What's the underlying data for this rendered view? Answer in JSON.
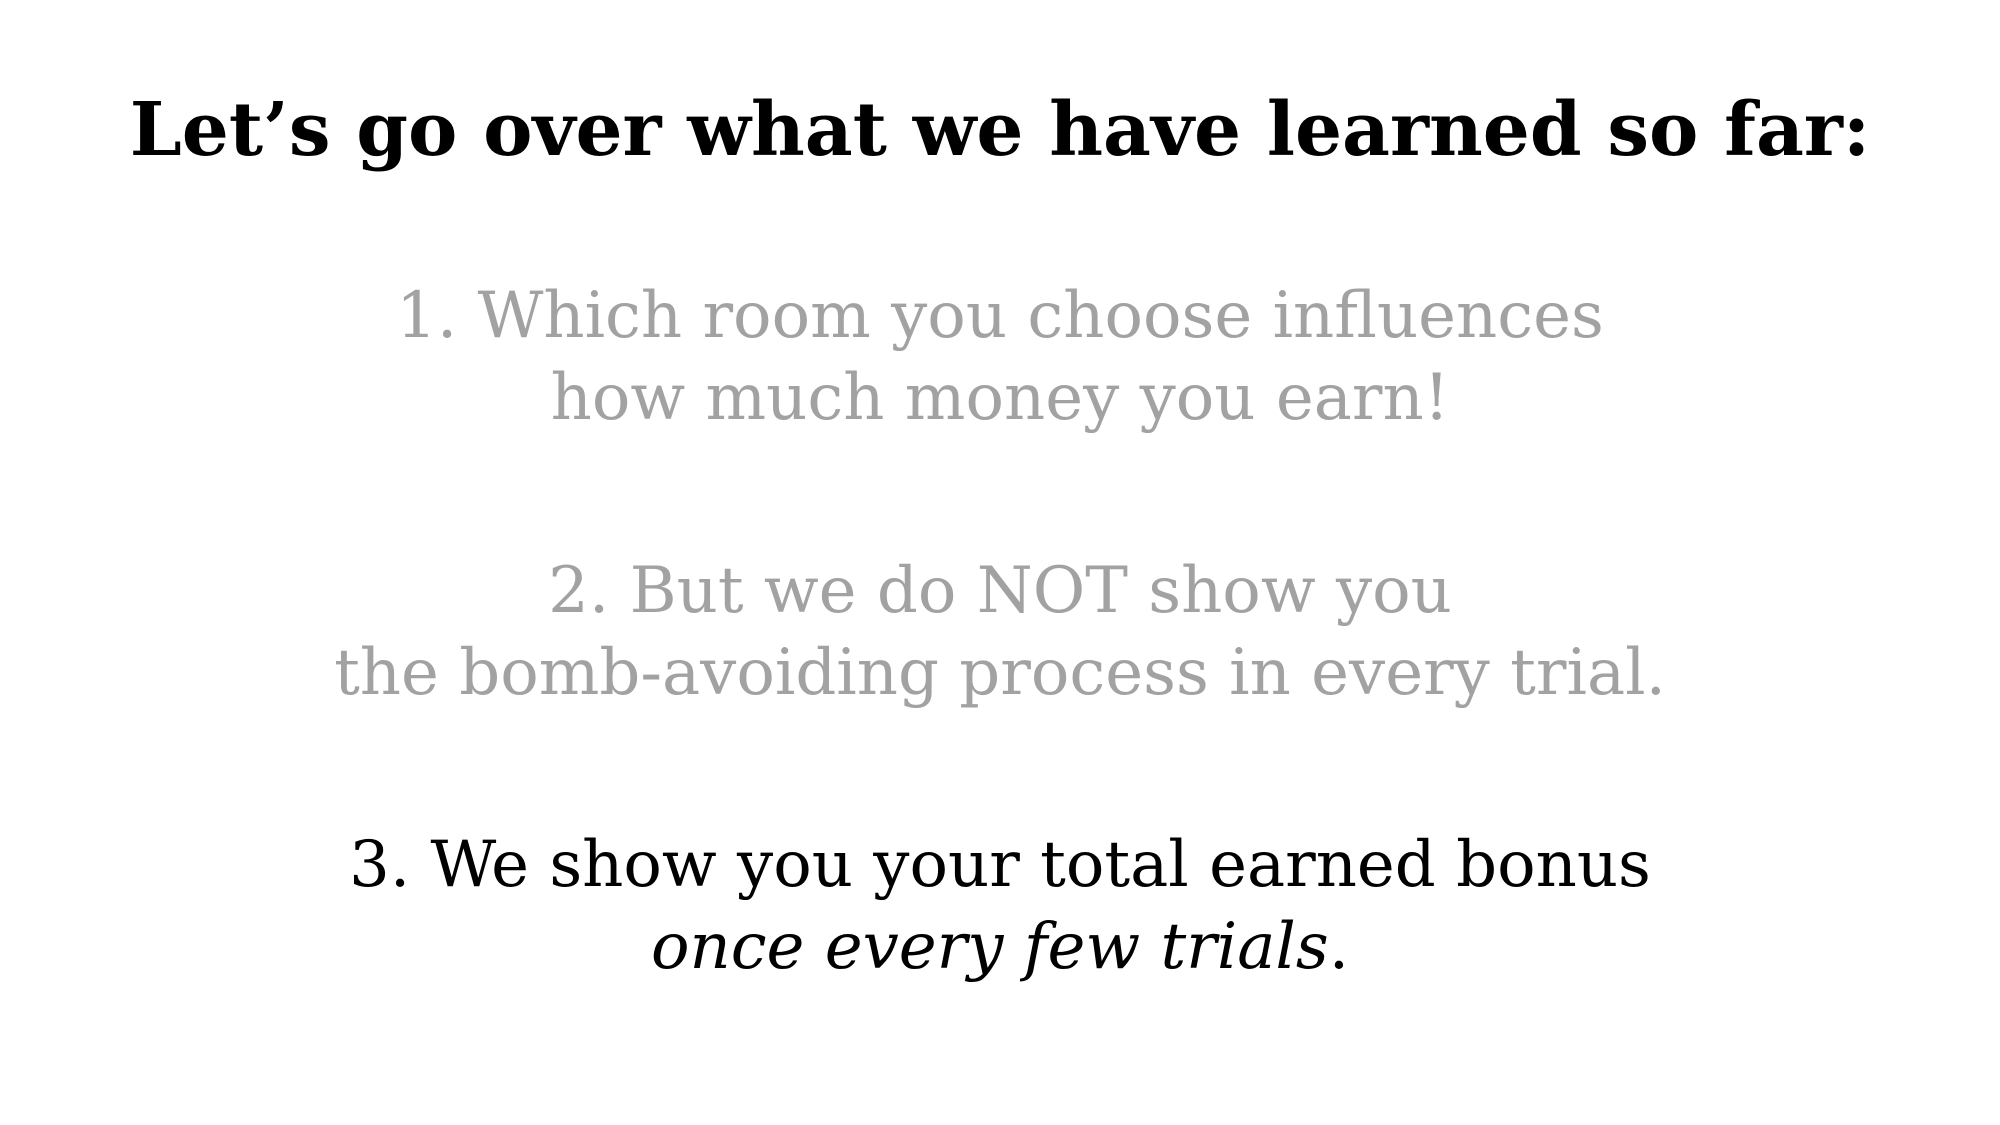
{
  "slide": {
    "title": "Let’s go over what we have learned so far:",
    "points": [
      {
        "line1": "1. Which room you choose influences",
        "line2": "how much money you earn!",
        "state": "dimmed"
      },
      {
        "line1": "2. But we do NOT show you",
        "line2": "the bomb-avoiding process in every trial.",
        "state": "dimmed"
      },
      {
        "line1": "3. We show you your total earned bonus",
        "line2_italic": "once every few trials",
        "line2_tail": ".",
        "state": "active"
      }
    ]
  },
  "colors": {
    "active_text": "#000000",
    "dimmed_text": "#a2a2a2",
    "background": "#ffffff"
  }
}
